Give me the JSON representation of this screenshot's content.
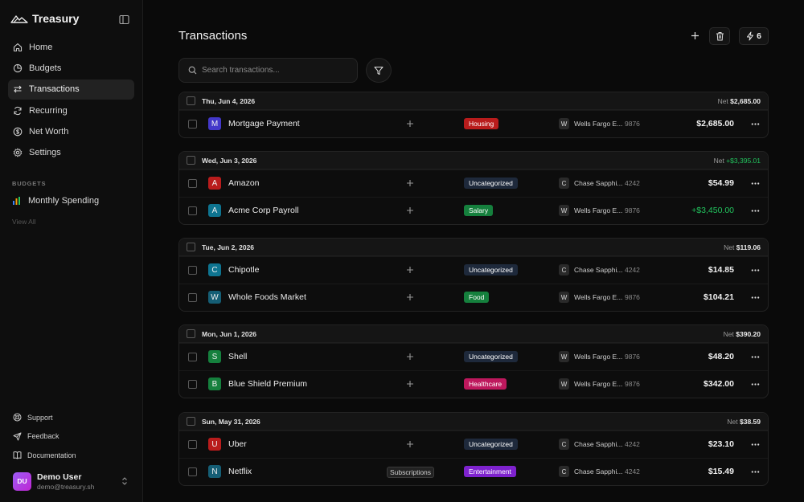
{
  "app": {
    "brand": "Treasury"
  },
  "sidebar": {
    "nav": [
      {
        "label": "Home",
        "icon": "home-icon"
      },
      {
        "label": "Budgets",
        "icon": "pie-chart-icon"
      },
      {
        "label": "Transactions",
        "icon": "arrows-swap-icon",
        "active": true
      },
      {
        "label": "Recurring",
        "icon": "refresh-icon"
      },
      {
        "label": "Net Worth",
        "icon": "dollar-circle-icon"
      },
      {
        "label": "Settings",
        "icon": "gear-icon"
      }
    ],
    "budgets_label": "BUDGETS",
    "budget_item": "Monthly Spending",
    "view_all": "View All",
    "footer": [
      {
        "label": "Support",
        "icon": "lifebuoy-icon"
      },
      {
        "label": "Feedback",
        "icon": "send-icon"
      },
      {
        "label": "Documentation",
        "icon": "book-icon"
      }
    ],
    "user": {
      "initials": "DU",
      "name": "Demo User",
      "email": "demo@treasury.sh"
    }
  },
  "header": {
    "title": "Transactions",
    "rules_count": "6"
  },
  "search": {
    "placeholder": "Search transactions..."
  },
  "colors": {
    "Housing": "#b91c1c",
    "Uncategorized": "#1e293b",
    "Salary": "#15803d",
    "Food": "#15803d",
    "Healthcare": "#be185d",
    "Entertainment": "#7e22ce",
    "positive": "#22c55e"
  },
  "groups": [
    {
      "date": "Thu, Jun 4, 2026",
      "net_label": "Net",
      "net": "$2,685.00",
      "net_positive": false,
      "rows": [
        {
          "letter": "M",
          "letter_color": "#4338ca",
          "merchant": "Mortgage Payment",
          "category": "Housing",
          "account_letter": "W",
          "account": "Wells Fargo E...",
          "mask": "9876",
          "amount": "$2,685.00",
          "positive": false
        }
      ]
    },
    {
      "date": "Wed, Jun 3, 2026",
      "net_label": "Net",
      "net": "+$3,395.01",
      "net_positive": true,
      "rows": [
        {
          "letter": "A",
          "letter_color": "#b91c1c",
          "merchant": "Amazon",
          "category": "Uncategorized",
          "account_letter": "C",
          "account": "Chase Sapphi...",
          "mask": "4242",
          "amount": "$54.99",
          "positive": false
        },
        {
          "letter": "A",
          "letter_color": "#0e7490",
          "merchant": "Acme Corp Payroll",
          "category": "Salary",
          "account_letter": "W",
          "account": "Wells Fargo E...",
          "mask": "9876",
          "amount": "+$3,450.00",
          "positive": true
        }
      ]
    },
    {
      "date": "Tue, Jun 2, 2026",
      "net_label": "Net",
      "net": "$119.06",
      "net_positive": false,
      "rows": [
        {
          "letter": "C",
          "letter_color": "#0e7490",
          "merchant": "Chipotle",
          "category": "Uncategorized",
          "account_letter": "C",
          "account": "Chase Sapphi...",
          "mask": "4242",
          "amount": "$14.85",
          "positive": false
        },
        {
          "letter": "W",
          "letter_color": "#155e75",
          "merchant": "Whole Foods Market",
          "category": "Food",
          "account_letter": "W",
          "account": "Wells Fargo E...",
          "mask": "9876",
          "amount": "$104.21",
          "positive": false
        }
      ]
    },
    {
      "date": "Mon, Jun 1, 2026",
      "net_label": "Net",
      "net": "$390.20",
      "net_positive": false,
      "rows": [
        {
          "letter": "S",
          "letter_color": "#15803d",
          "merchant": "Shell",
          "category": "Uncategorized",
          "account_letter": "W",
          "account": "Wells Fargo E...",
          "mask": "9876",
          "amount": "$48.20",
          "positive": false
        },
        {
          "letter": "B",
          "letter_color": "#15803d",
          "merchant": "Blue Shield Premium",
          "category": "Healthcare",
          "account_letter": "W",
          "account": "Wells Fargo E...",
          "mask": "9876",
          "amount": "$342.00",
          "positive": false
        }
      ]
    },
    {
      "date": "Sun, May 31, 2026",
      "net_label": "Net",
      "net": "$38.59",
      "net_positive": false,
      "rows": [
        {
          "letter": "U",
          "letter_color": "#b91c1c",
          "merchant": "Uber",
          "category": "Uncategorized",
          "account_letter": "C",
          "account": "Chase Sapphi...",
          "mask": "4242",
          "amount": "$23.10",
          "positive": false
        },
        {
          "letter": "N",
          "letter_color": "#155e75",
          "merchant": "Netflix",
          "recurring": "Subscriptions",
          "category": "Entertainment",
          "account_letter": "C",
          "account": "Chase Sapphi...",
          "mask": "4242",
          "amount": "$15.49",
          "positive": false
        }
      ]
    }
  ]
}
